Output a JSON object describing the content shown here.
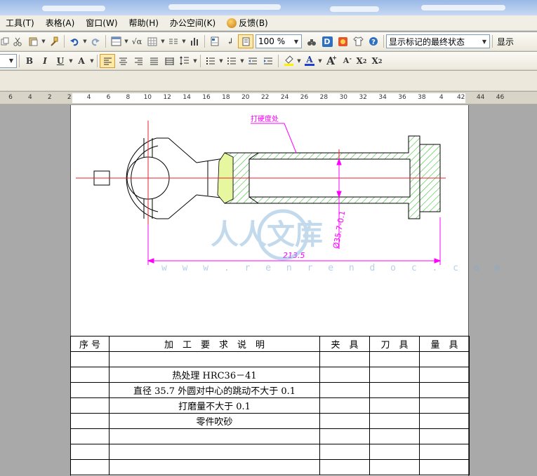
{
  "menu": {
    "items": [
      {
        "label": "工具(T)"
      },
      {
        "label": "表格(A)"
      },
      {
        "label": "窗口(W)"
      },
      {
        "label": "帮助(H)"
      },
      {
        "label": "办公空间(K)"
      },
      {
        "label": "反馈(B)"
      }
    ]
  },
  "toolbar": {
    "zoom_value": "100 %",
    "markup_mode": "显示标记的最终状态",
    "show_label": "显示",
    "font_size_value": "",
    "bold": "B",
    "italic": "I",
    "underline": "U",
    "font_color": "A",
    "grow_font": "A",
    "shrink_font": "A",
    "superscript": "X",
    "superscript_mark": "2",
    "subscript": "X",
    "subscript_mark": "2",
    "d_button": "D"
  },
  "ruler": {
    "ticks": [
      "6",
      "4",
      "2",
      "2",
      "4",
      "6",
      "8",
      "10",
      "12",
      "14",
      "16",
      "18",
      "20",
      "22",
      "24",
      "26",
      "28",
      "30",
      "32",
      "34",
      "36",
      "38",
      "4",
      "42",
      "44",
      "46"
    ]
  },
  "drawing": {
    "hard_head_label": "打硬度处",
    "diameter_label": "Ø35.7-0.1",
    "length_label": "213.5",
    "watermark_text": "w w w . r e n r e n d o c . c o m",
    "watermark_logo": "人人文库",
    "line_red": "#e8212b",
    "dim_magenta": "#ff00ff",
    "hatch_green": "#3cbf33"
  },
  "table": {
    "headers": [
      "序 号",
      "加　工　要　求　说　明",
      "夹　具",
      "刀　具",
      "量　具"
    ],
    "rows": [
      [
        "",
        "",
        "",
        "",
        ""
      ],
      [
        "",
        "热处理 HRC36－41",
        "",
        "",
        ""
      ],
      [
        "",
        "直径 35.7 外圆对中心的跳动不大于 0.1",
        "",
        "",
        ""
      ],
      [
        "",
        "打磨量不大于 0.1",
        "",
        "",
        ""
      ],
      [
        "",
        "零件吹砂",
        "",
        "",
        ""
      ],
      [
        "",
        "",
        "",
        "",
        ""
      ],
      [
        "",
        "",
        "",
        "",
        ""
      ],
      [
        "",
        "",
        "",
        "",
        ""
      ]
    ]
  }
}
